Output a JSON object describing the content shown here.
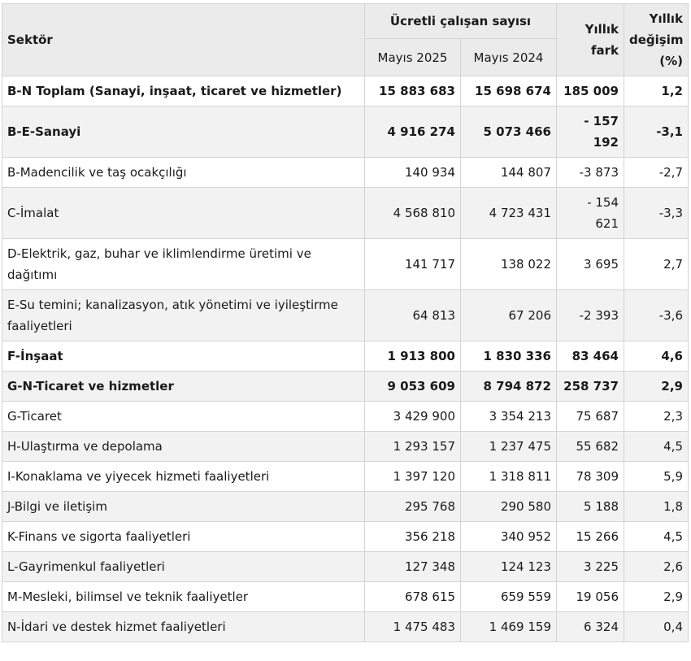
{
  "table": {
    "headers": {
      "sector": "Sektör",
      "group": "Ücretli çalışan sayısı",
      "may2025": "Mayıs 2025",
      "may2024": "Mayıs 2024",
      "annual_diff_line1": "Yıllık",
      "annual_diff_line2": "fark",
      "annual_change_line1": "Yıllık",
      "annual_change_line2": "değişim",
      "annual_change_line3": "(%)"
    },
    "rows": [
      {
        "sector": "B-N Toplam (Sanayi, inşaat, ticaret ve hizmetler)",
        "may2025": "15 883 683",
        "may2024": "15 698 674",
        "diff": "185 009",
        "pct": "1,2"
      },
      {
        "sector": "B-E-Sanayi",
        "may2025": "4 916 274",
        "may2024": "5 073 466",
        "diff": "- 157 192",
        "pct": "-3,1"
      },
      {
        "sector": "B-Madencilik ve taş ocakçılığı",
        "may2025": "140 934",
        "may2024": "144 807",
        "diff": "-3 873",
        "pct": "-2,7"
      },
      {
        "sector": "C-İmalat",
        "may2025": "4 568 810",
        "may2024": "4 723 431",
        "diff": "- 154 621",
        "pct": "-3,3"
      },
      {
        "sector": "D-Elektrik, gaz, buhar ve iklimlendirme üretimi ve dağıtımı",
        "may2025": "141 717",
        "may2024": "138 022",
        "diff": "3 695",
        "pct": "2,7"
      },
      {
        "sector": "E-Su temini; kanalizasyon, atık yönetimi ve iyileştirme faaliyetleri",
        "may2025": "64 813",
        "may2024": "67 206",
        "diff": "-2 393",
        "pct": "-3,6"
      },
      {
        "sector": "F-İnşaat",
        "may2025": "1 913 800",
        "may2024": "1 830 336",
        "diff": "83 464",
        "pct": "4,6"
      },
      {
        "sector": "G-N-Ticaret ve hizmetler",
        "may2025": "9 053 609",
        "may2024": "8 794 872",
        "diff": "258 737",
        "pct": "2,9"
      },
      {
        "sector": "G-Ticaret",
        "may2025": "3 429 900",
        "may2024": "3 354 213",
        "diff": "75 687",
        "pct": "2,3"
      },
      {
        "sector": "H-Ulaştırma ve depolama",
        "may2025": "1 293 157",
        "may2024": "1 237 475",
        "diff": "55 682",
        "pct": "4,5"
      },
      {
        "sector": "I-Konaklama ve yiyecek hizmeti faaliyetleri",
        "may2025": "1 397 120",
        "may2024": "1 318 811",
        "diff": "78 309",
        "pct": "5,9"
      },
      {
        "sector": "J-Bilgi ve iletişim",
        "may2025": "295 768",
        "may2024": "290 580",
        "diff": "5 188",
        "pct": "1,8"
      },
      {
        "sector": "K-Finans ve sigorta faaliyetleri",
        "may2025": "356 218",
        "may2024": "340 952",
        "diff": "15 266",
        "pct": "4,5"
      },
      {
        "sector": "L-Gayrimenkul faaliyetleri",
        "may2025": "127 348",
        "may2024": "124 123",
        "diff": "3 225",
        "pct": "2,6"
      },
      {
        "sector": "M-Mesleki, bilimsel ve teknik faaliyetler",
        "may2025": "678 615",
        "may2024": "659 559",
        "diff": "19 056",
        "pct": "2,9"
      },
      {
        "sector": "N-İdari ve destek hizmet faaliyetleri",
        "may2025": "1 475 483",
        "may2024": "1 469 159",
        "diff": "6 324",
        "pct": "0,4"
      }
    ]
  }
}
